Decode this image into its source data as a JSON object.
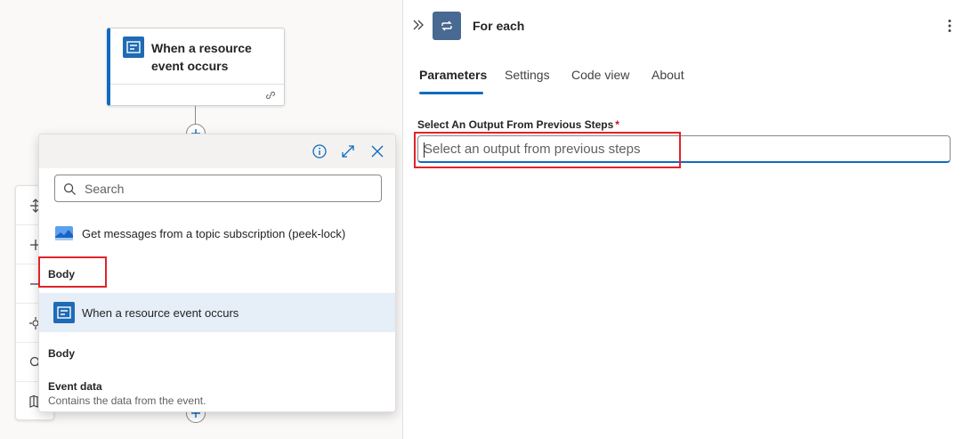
{
  "trigger_card": {
    "title": "When a resource event occurs"
  },
  "dynamic_content": {
    "search_placeholder": "Search",
    "groups": [
      {
        "label": "Get messages from a topic subscription (peek-lock)",
        "icon": "service-bus-icon"
      },
      {
        "label": "When a resource event occurs",
        "icon": "event-grid-icon"
      }
    ],
    "tokens": {
      "sb_body": "Body",
      "trigger_body": "Body",
      "event_data": "Event data",
      "event_data_desc": "Contains the data from the event."
    },
    "header_icons": [
      "info-icon",
      "expand-icon",
      "close-icon"
    ]
  },
  "left_toolbar": {
    "icons": [
      "fit-height-icon",
      "zoom-in-icon",
      "zoom-out-icon",
      "center-icon",
      "search-icon",
      "minimap-icon"
    ]
  },
  "panel": {
    "title": "For each",
    "tabs": [
      "Parameters",
      "Settings",
      "Code view",
      "About"
    ],
    "active_tab": "Parameters",
    "field_label": "Select An Output From Previous Steps",
    "field_required": "*",
    "field_placeholder": "Select an output from previous steps"
  },
  "colors": {
    "accent": "#0f6cbd",
    "highlight": "#e0242a",
    "foreach_icon_bg": "#486991",
    "trigger_icon_bg": "#1f6bb5"
  }
}
